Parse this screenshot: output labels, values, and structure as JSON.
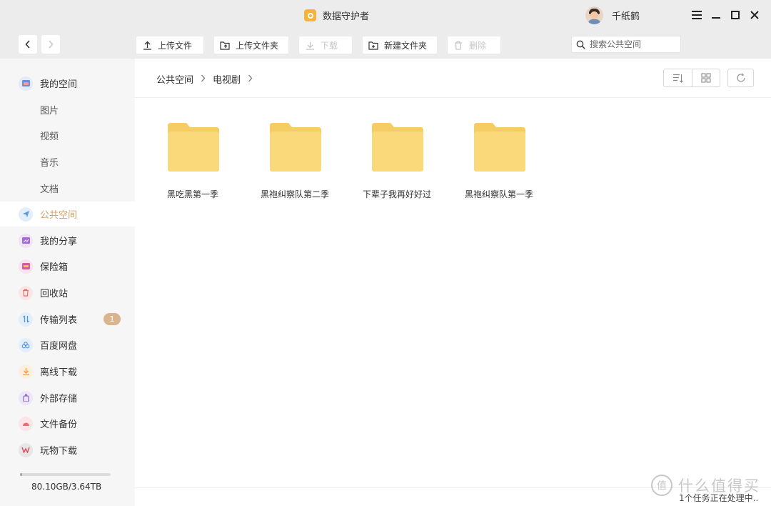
{
  "window": {
    "title": "数据守护者",
    "user_name": "千纸鹤",
    "controls": [
      "menu-icon",
      "minimize-icon",
      "maximize-icon",
      "close-icon"
    ]
  },
  "nav": {
    "back_icon": "chevron-left-icon",
    "forward_icon": "chevron-right-icon"
  },
  "toolbar": {
    "upload_file": "上传文件",
    "upload_folder": "上传文件夹",
    "download": "下载",
    "new_folder": "新建文件夹",
    "delete": "删除"
  },
  "search": {
    "placeholder": "搜索公共空间",
    "value": ""
  },
  "sidebar": {
    "my_space": "我的空间",
    "sub_items": [
      "图片",
      "视频",
      "音乐",
      "文档"
    ],
    "public_space": "公共空间",
    "my_share": "我的分享",
    "safe_box": "保险箱",
    "recycle": "回收站",
    "transfer": "传输列表",
    "transfer_badge": "1",
    "baidu": "百度网盘",
    "offline": "离线下载",
    "external": "外部存储",
    "backup": "文件备份",
    "toy": "玩物下载",
    "storage": "80.10GB/3.64TB",
    "storage_used_fraction": 0.021
  },
  "breadcrumb": [
    "公共空间",
    "电视剧"
  ],
  "folders": [
    "黑吃黑第一季",
    "黑袍纠察队第二季",
    "下辈子我再好好过",
    "黑袍纠察队第一季"
  ],
  "status": "1个任务正在处理中..",
  "watermark": "什么值得买",
  "colors": {
    "accent": "#d7a05c",
    "folder": "#f9d97a",
    "folder_tab": "#f5cd62"
  }
}
